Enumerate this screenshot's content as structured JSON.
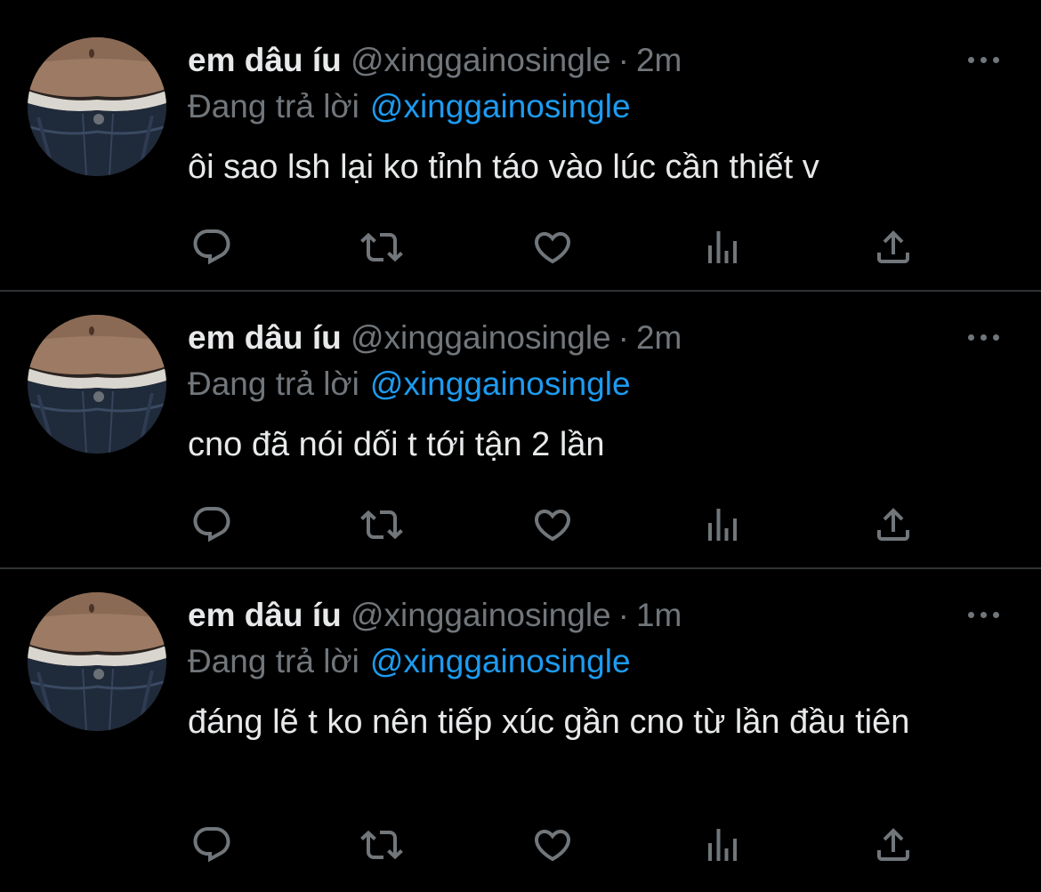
{
  "colors": {
    "background": "#000000",
    "text": "#e7e9ea",
    "muted": "#71767b",
    "accent": "#1d9bf0",
    "divider": "#2f3336"
  },
  "icons": [
    "reply-icon",
    "retweet-icon",
    "like-icon",
    "analytics-icon",
    "share-icon",
    "more-icon"
  ],
  "tweets": [
    {
      "name": "em dâu íu",
      "handle": "@xinggainosingle",
      "separator": "·",
      "time": "2m",
      "reply_prefix": "Đang trả lời",
      "reply_to": "@xinggainosingle",
      "text": "ôi sao lsh lại ko tỉnh táo vào lúc cần thiết v"
    },
    {
      "name": "em dâu íu",
      "handle": "@xinggainosingle",
      "separator": "·",
      "time": "2m",
      "reply_prefix": "Đang trả lời",
      "reply_to": "@xinggainosingle",
      "text": "cno đã nói dối t tới tận 2 lần"
    },
    {
      "name": "em dâu íu",
      "handle": "@xinggainosingle",
      "separator": "·",
      "time": "1m",
      "reply_prefix": "Đang trả lời",
      "reply_to": "@xinggainosingle",
      "text": "đáng lẽ t ko nên tiếp xúc gần cno từ lần đầu tiên"
    }
  ]
}
